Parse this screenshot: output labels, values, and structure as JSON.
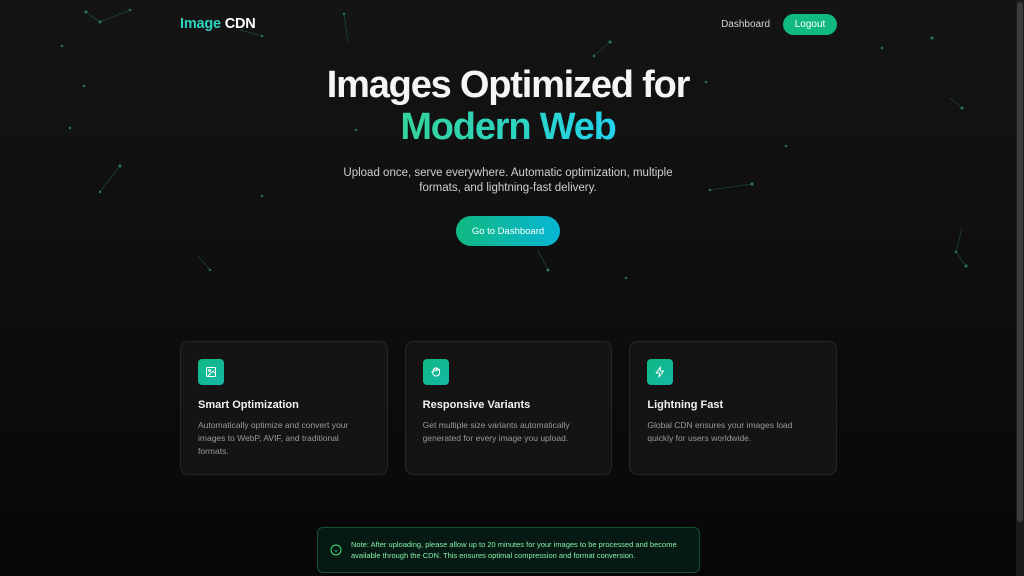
{
  "header": {
    "logo_primary": "Image",
    "logo_secondary": "CDN",
    "nav_dashboard": "Dashboard",
    "logout_label": "Logout"
  },
  "hero": {
    "title_line1": "Images Optimized for",
    "title_line2": "Modern Web",
    "subtitle": "Upload once, serve everywhere. Automatic optimization, multiple formats, and lightning-fast delivery.",
    "cta_label": "Go to Dashboard"
  },
  "features": [
    {
      "icon": "image-icon",
      "title": "Smart Optimization",
      "description": "Automatically optimize and convert your images to WebP, AVIF, and traditional formats."
    },
    {
      "icon": "hand-icon",
      "title": "Responsive Variants",
      "description": "Get multiple size variants automatically generated for every image you upload."
    },
    {
      "icon": "lightning-icon",
      "title": "Lightning Fast",
      "description": "Global CDN ensures your images load quickly for users worldwide."
    }
  ],
  "note": {
    "icon": "info-icon",
    "text": "Note: After uploading, please allow up to 20 minutes for your images to be processed and become available through the CDN. This ensures optimal compression and format conversion."
  },
  "colors": {
    "accent": "#10b981",
    "accent_cyan": "#06b6d4",
    "background": "#0f0f10",
    "note_text": "#86efac"
  }
}
